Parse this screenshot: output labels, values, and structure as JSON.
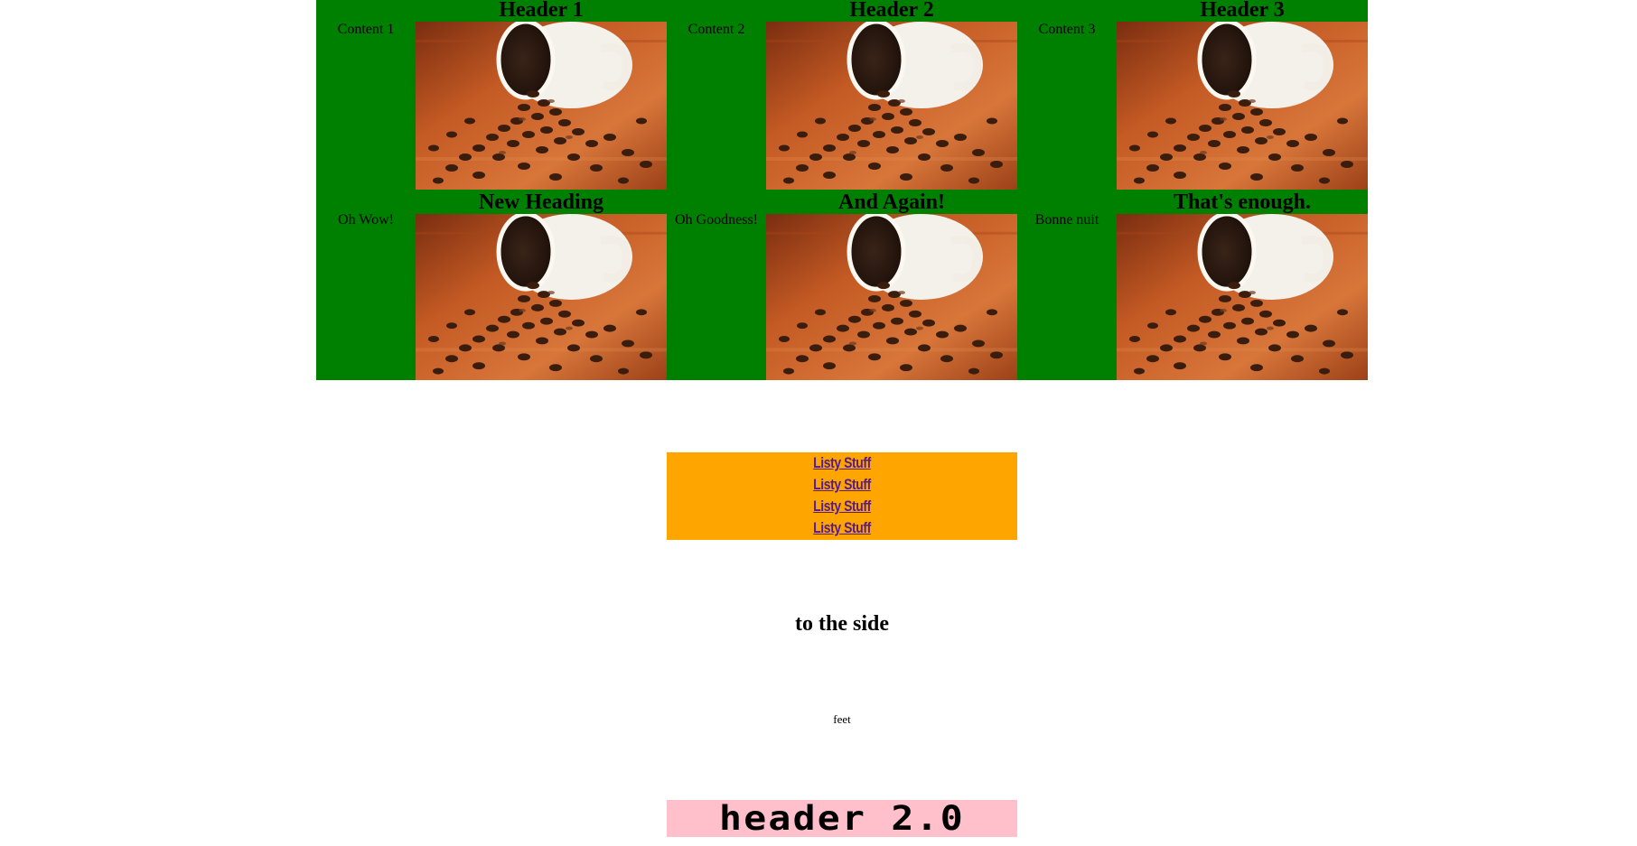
{
  "grid": {
    "rows": [
      [
        {
          "heading": "Header 1",
          "content": "Content 1"
        },
        {
          "heading": "Header 2",
          "content": "Content 2"
        },
        {
          "heading": "Header 3",
          "content": "Content 3"
        }
      ],
      [
        {
          "heading": "New Heading",
          "content": "Oh Wow!"
        },
        {
          "heading": "And Again!",
          "content": "Oh Goodness!"
        },
        {
          "heading": "That's enough.",
          "content": "Bonne nuit"
        }
      ]
    ]
  },
  "list": {
    "items": [
      "Listy Stuff",
      "Listy Stuff",
      "Listy Stuff",
      "Listy Stuff"
    ]
  },
  "side_heading": "to the side",
  "footer_text": "feet",
  "header2": "header 2.0",
  "colors": {
    "grid_bg": "#008000",
    "list_bg": "#ffa500",
    "link": "#551a8b",
    "header2_bg": "#ffc0cb"
  }
}
